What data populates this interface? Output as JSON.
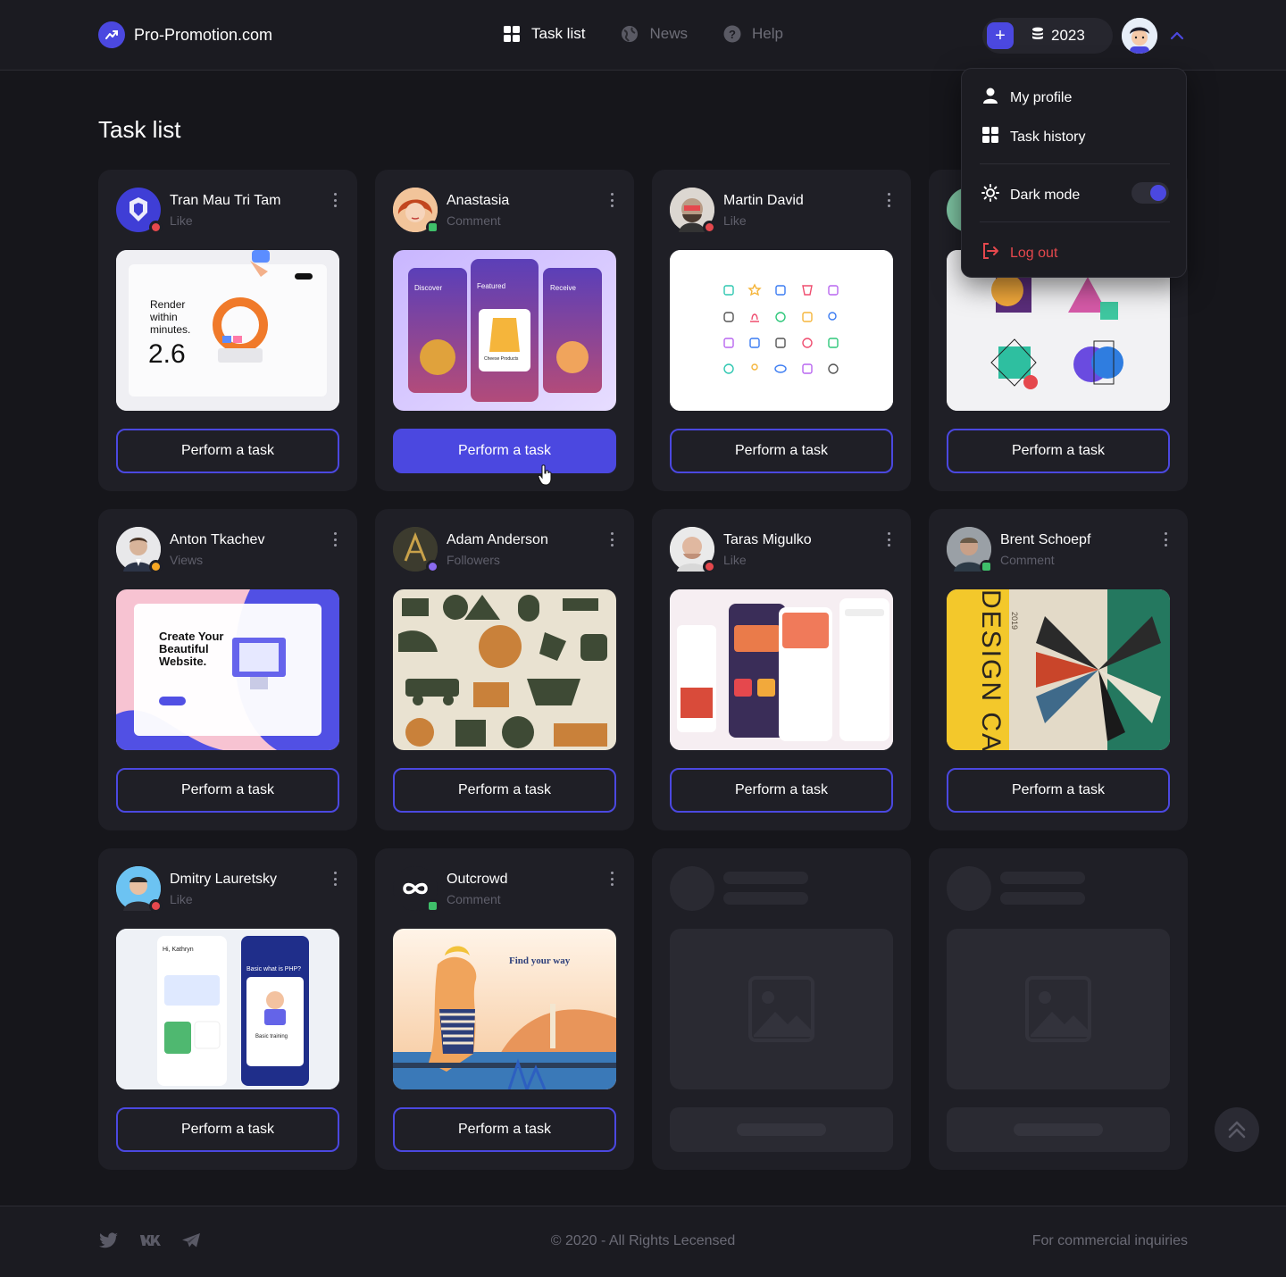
{
  "brand": {
    "name": "Pro-Promotion.com",
    "accent": "#4b48e0"
  },
  "nav": [
    {
      "label": "Task list",
      "icon": "grid-icon",
      "active": true
    },
    {
      "label": "News",
      "icon": "globe-icon",
      "active": false
    },
    {
      "label": "Help",
      "icon": "help-icon",
      "active": false
    }
  ],
  "balance": {
    "value": "2023",
    "add_label": "+"
  },
  "page": {
    "title": "Task list"
  },
  "menu": {
    "profile": "My profile",
    "history": "Task history",
    "dark_mode": "Dark mode",
    "dark_mode_on": true,
    "logout": "Log out"
  },
  "cards": [
    {
      "name": "Tran Mau Tri Tam",
      "kind": "Like",
      "button": "Perform a task"
    },
    {
      "name": "Anastasia",
      "kind": "Comment",
      "button": "Perform a task"
    },
    {
      "name": "Martin David",
      "kind": "Like",
      "button": "Perform a task"
    },
    {
      "name": "",
      "kind": "",
      "button": "Perform a task"
    },
    {
      "name": "Anton Tkachev",
      "kind": "Views",
      "button": "Perform a task"
    },
    {
      "name": "Adam Anderson",
      "kind": "Followers",
      "button": "Perform a task"
    },
    {
      "name": "Taras Migulko",
      "kind": "Like",
      "button": "Perform a task"
    },
    {
      "name": "Brent Schoepf",
      "kind": "Comment",
      "button": "Perform a task"
    },
    {
      "name": "Dmitry Lauretsky",
      "kind": "Like",
      "button": "Perform a task"
    },
    {
      "name": "Outcrowd",
      "kind": "Comment",
      "button": "Perform a task"
    }
  ],
  "thumb_text": {
    "render": "Render within minutes.",
    "render_value": "2.6",
    "app1": "Discover",
    "app2": "Featured",
    "app3": "Receive",
    "app_product": "Cheese Products",
    "site_title": "Create Your Beautiful Website.",
    "design_camp": "DESIGN CAMP",
    "design_year": "2019",
    "edu_greeting": "Hi, Kathryn",
    "edu_course": "Basic what is PHP?",
    "edu_training": "Basic training",
    "outcrowd_title": "Find your way"
  },
  "footer": {
    "copyright": "© 2020 - All Rights Lecensed",
    "inquiries": "For commercial inquiries"
  }
}
